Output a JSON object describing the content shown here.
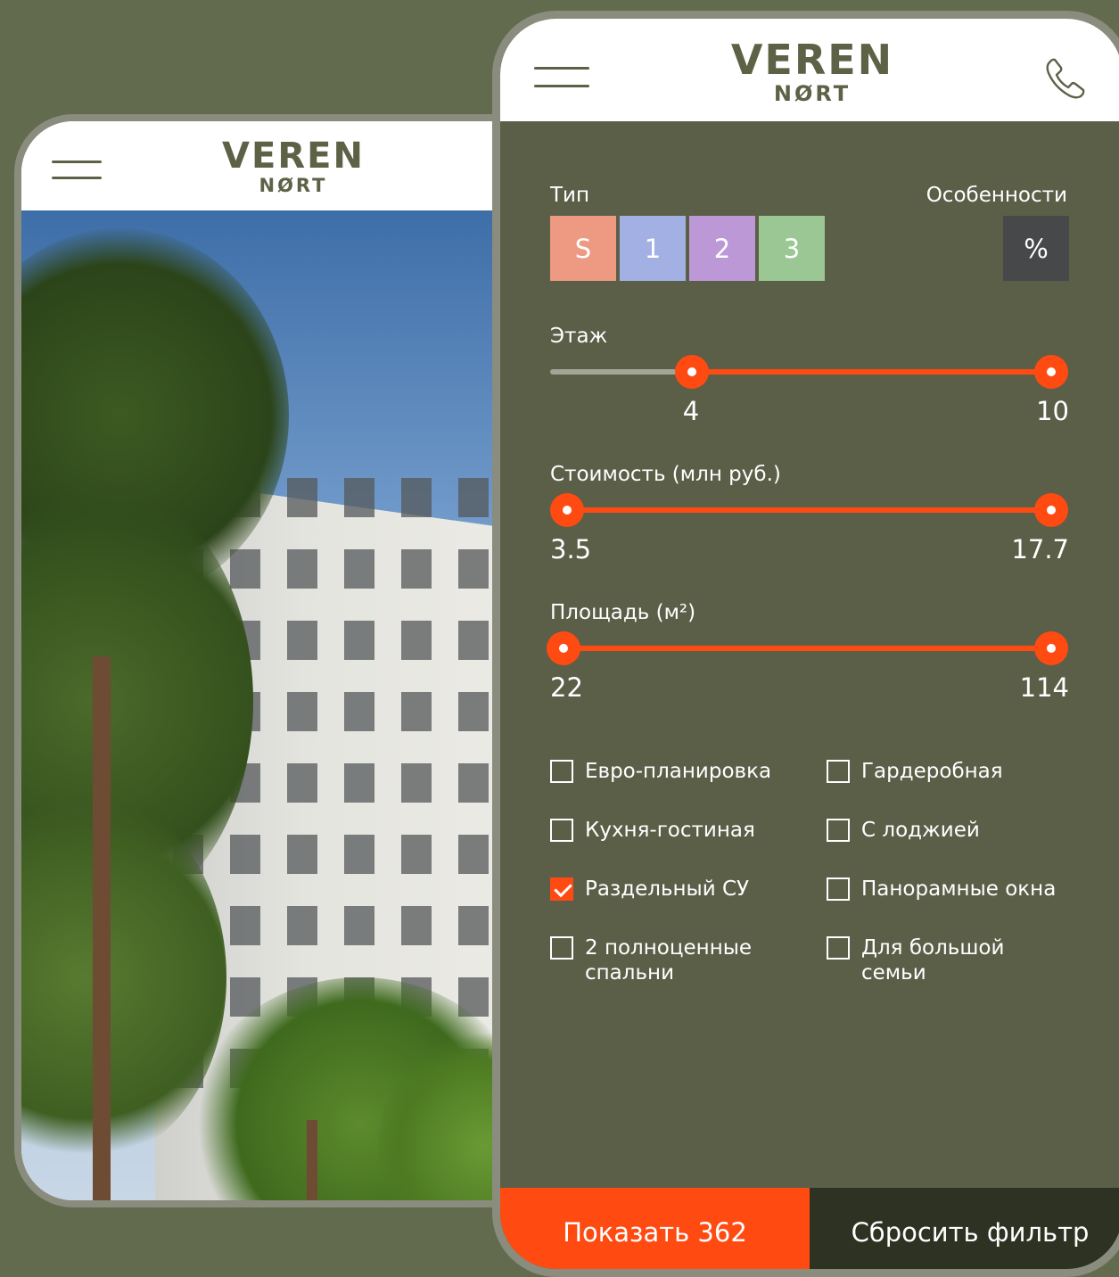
{
  "brand": {
    "name": "VEREN",
    "sub": "NØRT"
  },
  "colors": {
    "background": "#636b4e",
    "panel": "#5b5f48",
    "accent": "#ff4a12",
    "type_s": "#ee9a82",
    "type_1": "#a3b0e3",
    "type_2": "#bc98d7",
    "type_3": "#9ac793",
    "features_btn": "#46484a",
    "reset_btn": "#2e3223"
  },
  "icons": [
    "menu-icon",
    "phone-icon",
    "checkmark-icon"
  ],
  "filter": {
    "type_label": "Тип",
    "features_label": "Особенности",
    "types": [
      "S",
      "1",
      "2",
      "3"
    ],
    "features_button": "%",
    "floor": {
      "label": "Этаж",
      "min": 4,
      "max": 10,
      "range_min": 1,
      "range_max": 10
    },
    "price": {
      "label": "Стоимость (млн руб.)",
      "min": "3.5",
      "max": "17.7"
    },
    "area": {
      "label": "Площадь (м²)",
      "min": "22",
      "max": "114"
    },
    "checkboxes": [
      {
        "label": "Евро-планировка",
        "checked": false
      },
      {
        "label": "Гардеробная",
        "checked": false
      },
      {
        "label": "Кухня-гостиная",
        "checked": false
      },
      {
        "label": "С лоджией",
        "checked": false
      },
      {
        "label": "Раздельный СУ",
        "checked": true
      },
      {
        "label": "Панорамные окна",
        "checked": false
      },
      {
        "label": "2 полноценные спальни",
        "checked": false
      },
      {
        "label": "Для большой семьи",
        "checked": false
      }
    ],
    "show_button": "Показать 362",
    "reset_button": "Сбросить фильтр"
  }
}
